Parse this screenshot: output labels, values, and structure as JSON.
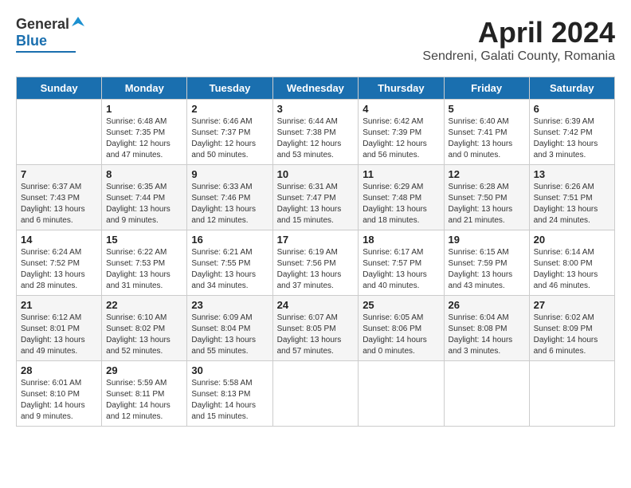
{
  "header": {
    "logo_general": "General",
    "logo_blue": "Blue",
    "title": "April 2024",
    "subtitle": "Sendreni, Galati County, Romania"
  },
  "calendar": {
    "days_header": [
      "Sunday",
      "Monday",
      "Tuesday",
      "Wednesday",
      "Thursday",
      "Friday",
      "Saturday"
    ],
    "weeks": [
      [
        {
          "day": "",
          "info": ""
        },
        {
          "day": "1",
          "info": "Sunrise: 6:48 AM\nSunset: 7:35 PM\nDaylight: 12 hours\nand 47 minutes."
        },
        {
          "day": "2",
          "info": "Sunrise: 6:46 AM\nSunset: 7:37 PM\nDaylight: 12 hours\nand 50 minutes."
        },
        {
          "day": "3",
          "info": "Sunrise: 6:44 AM\nSunset: 7:38 PM\nDaylight: 12 hours\nand 53 minutes."
        },
        {
          "day": "4",
          "info": "Sunrise: 6:42 AM\nSunset: 7:39 PM\nDaylight: 12 hours\nand 56 minutes."
        },
        {
          "day": "5",
          "info": "Sunrise: 6:40 AM\nSunset: 7:41 PM\nDaylight: 13 hours\nand 0 minutes."
        },
        {
          "day": "6",
          "info": "Sunrise: 6:39 AM\nSunset: 7:42 PM\nDaylight: 13 hours\nand 3 minutes."
        }
      ],
      [
        {
          "day": "7",
          "info": "Sunrise: 6:37 AM\nSunset: 7:43 PM\nDaylight: 13 hours\nand 6 minutes."
        },
        {
          "day": "8",
          "info": "Sunrise: 6:35 AM\nSunset: 7:44 PM\nDaylight: 13 hours\nand 9 minutes."
        },
        {
          "day": "9",
          "info": "Sunrise: 6:33 AM\nSunset: 7:46 PM\nDaylight: 13 hours\nand 12 minutes."
        },
        {
          "day": "10",
          "info": "Sunrise: 6:31 AM\nSunset: 7:47 PM\nDaylight: 13 hours\nand 15 minutes."
        },
        {
          "day": "11",
          "info": "Sunrise: 6:29 AM\nSunset: 7:48 PM\nDaylight: 13 hours\nand 18 minutes."
        },
        {
          "day": "12",
          "info": "Sunrise: 6:28 AM\nSunset: 7:50 PM\nDaylight: 13 hours\nand 21 minutes."
        },
        {
          "day": "13",
          "info": "Sunrise: 6:26 AM\nSunset: 7:51 PM\nDaylight: 13 hours\nand 24 minutes."
        }
      ],
      [
        {
          "day": "14",
          "info": "Sunrise: 6:24 AM\nSunset: 7:52 PM\nDaylight: 13 hours\nand 28 minutes."
        },
        {
          "day": "15",
          "info": "Sunrise: 6:22 AM\nSunset: 7:53 PM\nDaylight: 13 hours\nand 31 minutes."
        },
        {
          "day": "16",
          "info": "Sunrise: 6:21 AM\nSunset: 7:55 PM\nDaylight: 13 hours\nand 34 minutes."
        },
        {
          "day": "17",
          "info": "Sunrise: 6:19 AM\nSunset: 7:56 PM\nDaylight: 13 hours\nand 37 minutes."
        },
        {
          "day": "18",
          "info": "Sunrise: 6:17 AM\nSunset: 7:57 PM\nDaylight: 13 hours\nand 40 minutes."
        },
        {
          "day": "19",
          "info": "Sunrise: 6:15 AM\nSunset: 7:59 PM\nDaylight: 13 hours\nand 43 minutes."
        },
        {
          "day": "20",
          "info": "Sunrise: 6:14 AM\nSunset: 8:00 PM\nDaylight: 13 hours\nand 46 minutes."
        }
      ],
      [
        {
          "day": "21",
          "info": "Sunrise: 6:12 AM\nSunset: 8:01 PM\nDaylight: 13 hours\nand 49 minutes."
        },
        {
          "day": "22",
          "info": "Sunrise: 6:10 AM\nSunset: 8:02 PM\nDaylight: 13 hours\nand 52 minutes."
        },
        {
          "day": "23",
          "info": "Sunrise: 6:09 AM\nSunset: 8:04 PM\nDaylight: 13 hours\nand 55 minutes."
        },
        {
          "day": "24",
          "info": "Sunrise: 6:07 AM\nSunset: 8:05 PM\nDaylight: 13 hours\nand 57 minutes."
        },
        {
          "day": "25",
          "info": "Sunrise: 6:05 AM\nSunset: 8:06 PM\nDaylight: 14 hours\nand 0 minutes."
        },
        {
          "day": "26",
          "info": "Sunrise: 6:04 AM\nSunset: 8:08 PM\nDaylight: 14 hours\nand 3 minutes."
        },
        {
          "day": "27",
          "info": "Sunrise: 6:02 AM\nSunset: 8:09 PM\nDaylight: 14 hours\nand 6 minutes."
        }
      ],
      [
        {
          "day": "28",
          "info": "Sunrise: 6:01 AM\nSunset: 8:10 PM\nDaylight: 14 hours\nand 9 minutes."
        },
        {
          "day": "29",
          "info": "Sunrise: 5:59 AM\nSunset: 8:11 PM\nDaylight: 14 hours\nand 12 minutes."
        },
        {
          "day": "30",
          "info": "Sunrise: 5:58 AM\nSunset: 8:13 PM\nDaylight: 14 hours\nand 15 minutes."
        },
        {
          "day": "",
          "info": ""
        },
        {
          "day": "",
          "info": ""
        },
        {
          "day": "",
          "info": ""
        },
        {
          "day": "",
          "info": ""
        }
      ]
    ]
  }
}
